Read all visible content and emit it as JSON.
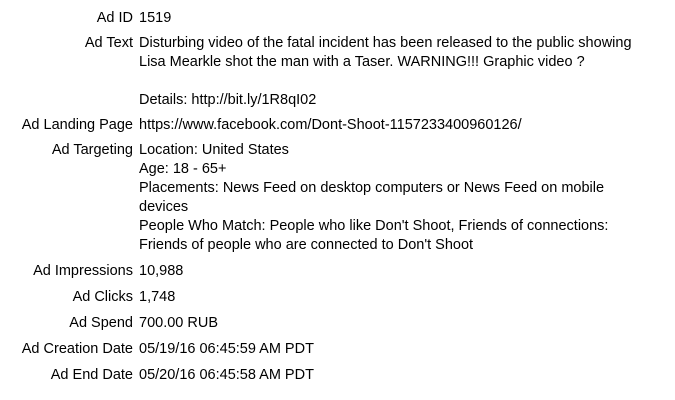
{
  "fields": {
    "ad_id": {
      "label": "Ad ID",
      "value": "1519"
    },
    "ad_text": {
      "label": "Ad Text",
      "lines": [
        "Disturbing video of the fatal incident has been released to the public showing",
        "Lisa Mearkle shot the man with a Taser. WARNING!!! Graphic video ?"
      ],
      "details": "Details: http://bit.ly/1R8qI02"
    },
    "ad_landing_page": {
      "label": "Ad Landing Page",
      "value": "https://www.facebook.com/Dont-Shoot-1157233400960126/"
    },
    "ad_targeting": {
      "label": "Ad Targeting",
      "lines": [
        "Location: United States",
        "Age: 18 - 65+",
        "Placements: News Feed on desktop computers or News Feed on mobile",
        "devices",
        "People Who Match: People who like Don't Shoot, Friends of connections:",
        "Friends of people who are connected to Don't Shoot"
      ]
    },
    "ad_impressions": {
      "label": "Ad Impressions",
      "value": "10,988"
    },
    "ad_clicks": {
      "label": "Ad Clicks",
      "value": "1,748"
    },
    "ad_spend": {
      "label": "Ad Spend",
      "value": "700.00 RUB"
    },
    "ad_creation_date": {
      "label": "Ad Creation Date",
      "value": "05/19/16 06:45:59 AM PDT"
    },
    "ad_end_date": {
      "label": "Ad End Date",
      "value": "05/20/16 06:45:58 AM PDT"
    }
  }
}
